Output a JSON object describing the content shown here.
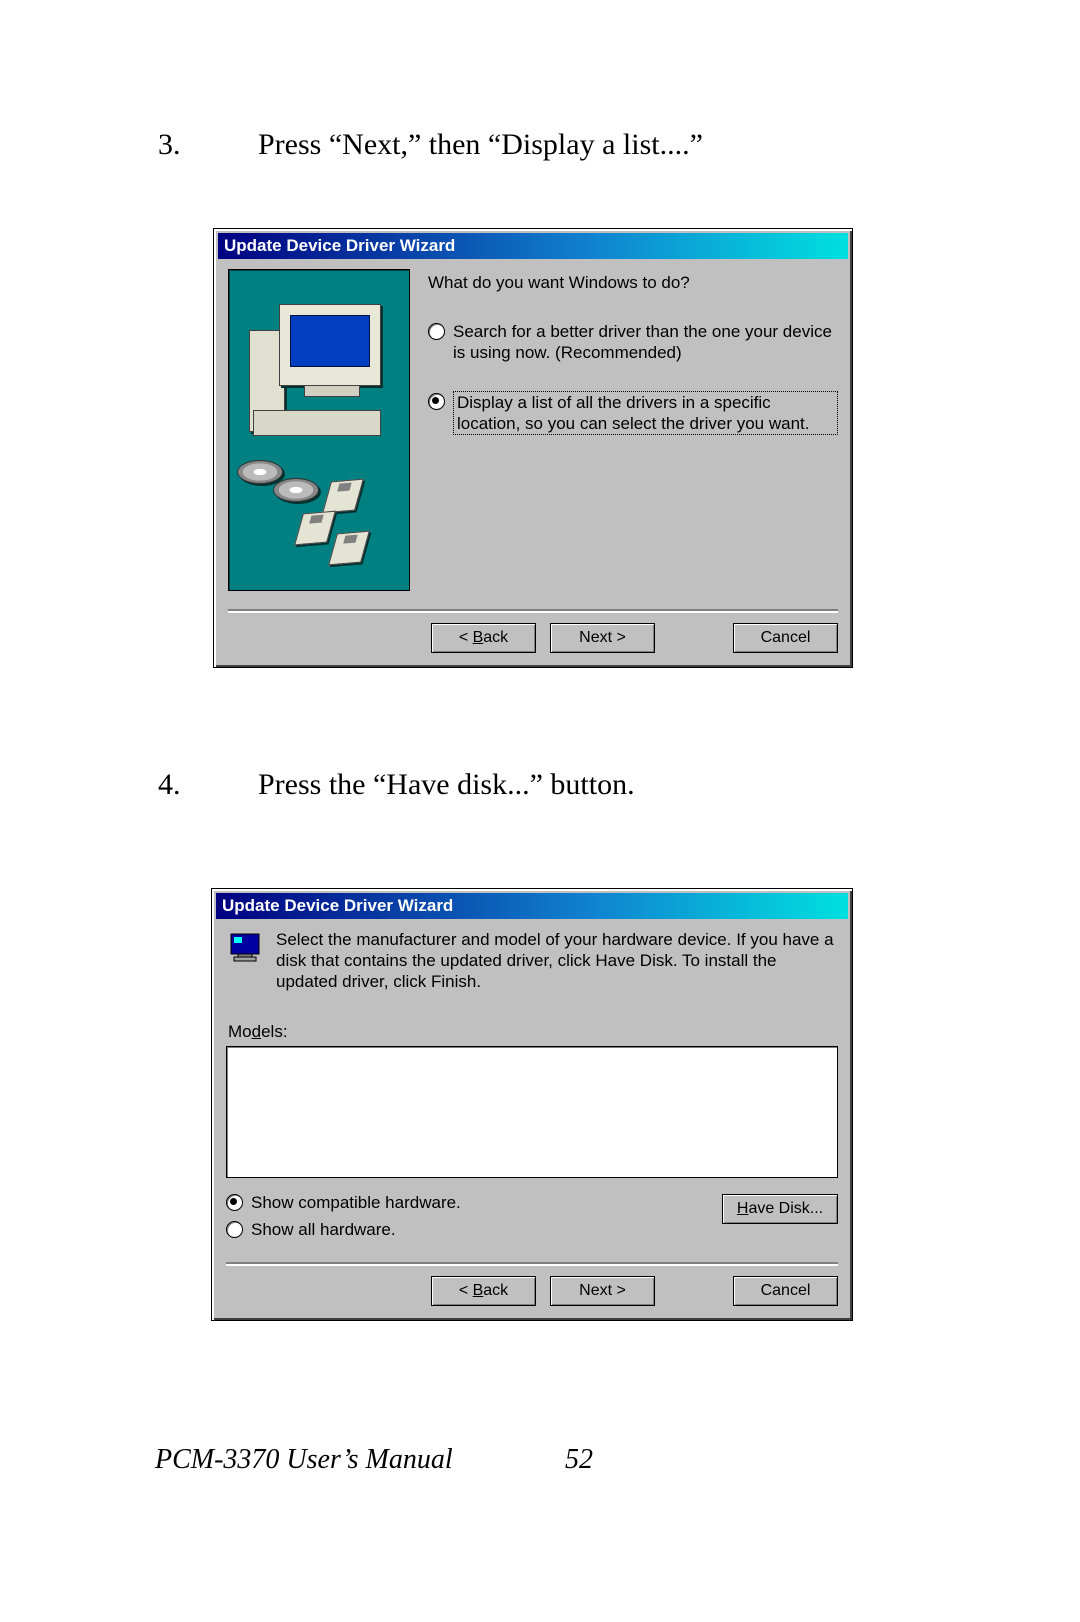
{
  "steps": {
    "s3_num": "3.",
    "s3_text": "Press “Next,” then “Display a list....”",
    "s4_num": "4.",
    "s4_text": "Press the “Have disk...” button."
  },
  "footer": {
    "manual": "PCM-3370 User’s Manual",
    "page": "52"
  },
  "wiz1": {
    "title": "Update Device Driver Wizard",
    "prompt": "What do you want Windows to do?",
    "opt1": "Search for a better driver than the one your device is using now. (Recommended)",
    "opt2": "Display a list of all the drivers in a specific location, so you can select the driver you want.",
    "back_pre": "< ",
    "back_u": "B",
    "back_post": "ack",
    "next": "Next >",
    "cancel": "Cancel"
  },
  "wiz2": {
    "title": "Update Device Driver Wizard",
    "instr": "Select the manufacturer and model of your hardware device. If you have a disk that contains the updated driver, click Have Disk. To install the updated driver, click Finish.",
    "models_pre": "Mo",
    "models_u": "d",
    "models_post": "els:",
    "show_compat_pre": "Show ",
    "show_compat_u": "c",
    "show_compat_post": "ompatible hardware.",
    "show_all_pre": "Show ",
    "show_all_u": "a",
    "show_all_post": "ll hardware.",
    "have_disk_u": "H",
    "have_disk_post": "ave Disk...",
    "back_pre": "< ",
    "back_u": "B",
    "back_post": "ack",
    "next": "Next >",
    "cancel": "Cancel"
  }
}
